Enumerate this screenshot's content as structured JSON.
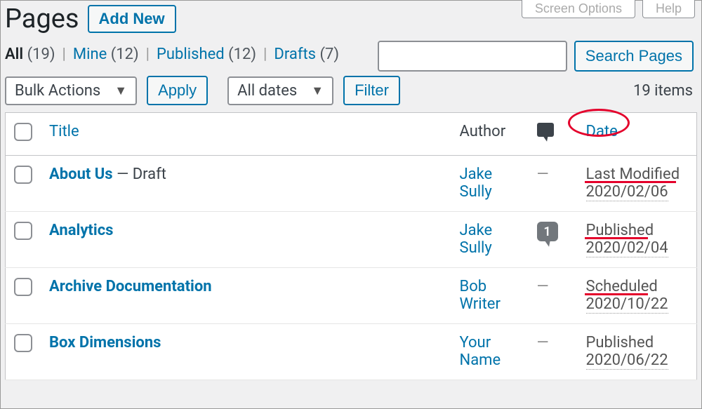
{
  "header": {
    "title": "Pages",
    "add_new": "Add New",
    "screen_options": "Screen Options",
    "help": "Help"
  },
  "filters": {
    "all_label": "All",
    "all_count": "(19)",
    "mine_label": "Mine",
    "mine_count": "(12)",
    "published_label": "Published",
    "published_count": "(12)",
    "drafts_label": "Drafts",
    "drafts_count": "(7)"
  },
  "search": {
    "button": "Search Pages"
  },
  "tablenav": {
    "bulk_actions": "Bulk Actions",
    "apply": "Apply",
    "all_dates": "All dates",
    "filter": "Filter",
    "items": "19 items"
  },
  "columns": {
    "title": "Title",
    "author": "Author",
    "date": "Date"
  },
  "rows": [
    {
      "title": "About Us",
      "state": " — Draft",
      "author": "Jake Sully",
      "comments": "—",
      "date_status": "Last Modified",
      "date_value": "2020/02/06"
    },
    {
      "title": "Analytics",
      "state": "",
      "author": "Jake Sully",
      "comments": "1",
      "date_status": "Published",
      "date_value": "2020/02/04"
    },
    {
      "title": "Archive Documentation",
      "state": "",
      "author": "Bob Writer",
      "comments": "—",
      "date_status": "Scheduled",
      "date_value": "2020/10/22"
    },
    {
      "title": "Box Dimensions",
      "state": "",
      "author": "Your Name",
      "comments": "—",
      "date_status": "Published",
      "date_value": "2020/06/22"
    }
  ]
}
